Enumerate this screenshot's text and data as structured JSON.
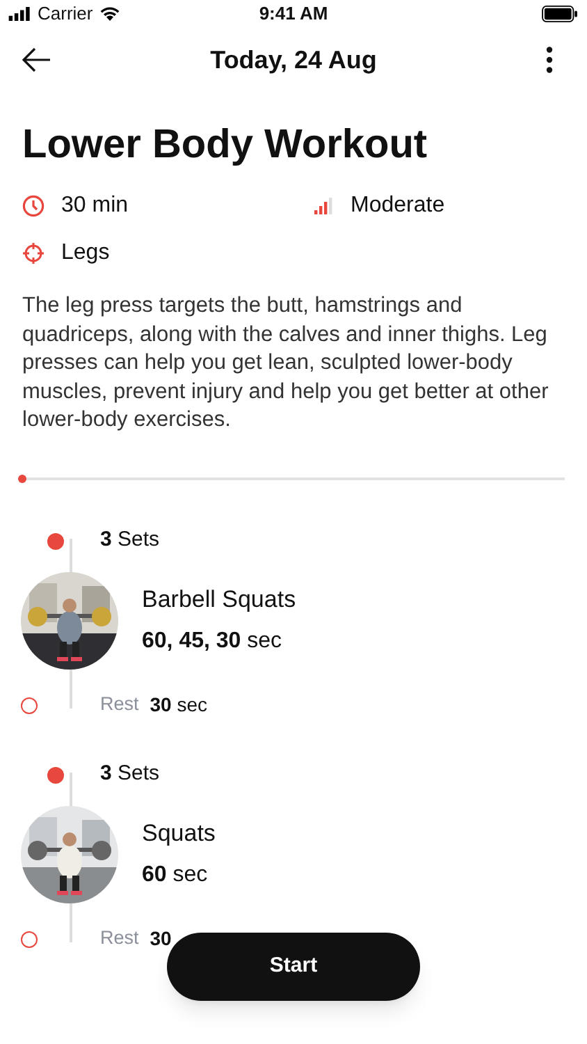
{
  "status_bar": {
    "carrier": "Carrier",
    "time": "9:41 AM"
  },
  "header": {
    "title": "Today, 24 Aug"
  },
  "workout": {
    "title": "Lower Body Workout",
    "duration": "30 min",
    "intensity": "Moderate",
    "target": "Legs",
    "description": "The leg press targets the butt, hamstrings and quadriceps, along with the calves and inner thighs. Leg presses can help you get lean, sculpted lower-body muscles, prevent injury and help you get better at other lower-body exercises.",
    "progress": {
      "level": 0
    }
  },
  "exercises": [
    {
      "sets": "**3** Sets",
      "name": "Barbell Squats",
      "duration": "**60, 45, 30** sec",
      "rest_label": "Rest",
      "rest": "**30** sec"
    },
    {
      "sets": "**3** Sets",
      "name": "Squats",
      "duration": "**60** sec",
      "rest_label": "Rest",
      "rest": "**30**"
    }
  ],
  "start_button": "Start"
}
